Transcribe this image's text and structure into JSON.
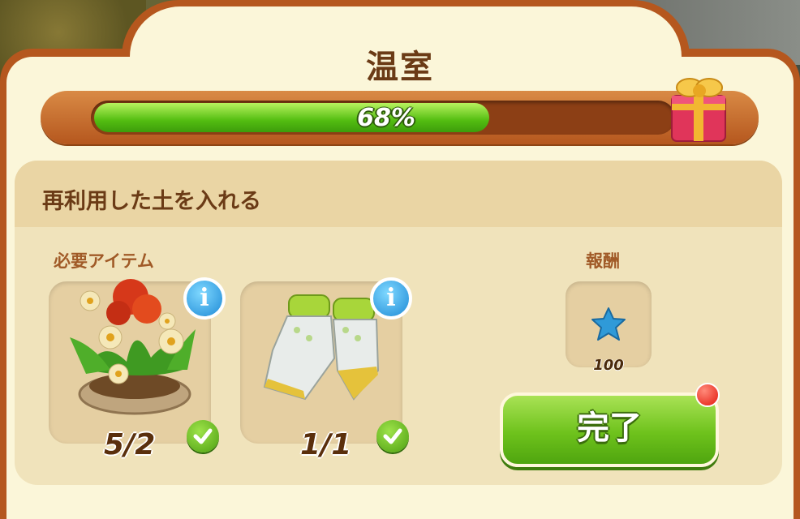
{
  "window": {
    "title": "温室"
  },
  "progress": {
    "label": "68%",
    "value": 0.68
  },
  "task": {
    "title": "再利用した土を入れる"
  },
  "required": {
    "label": "必要アイテム",
    "items": [
      {
        "icon": "flower-pot-icon",
        "count": "5/2",
        "complete": true
      },
      {
        "icon": "gardening-gloves-icon",
        "count": "1/1",
        "complete": true
      }
    ]
  },
  "reward": {
    "label": "報酬",
    "icon": "blue-star-icon",
    "amount": "100"
  },
  "actions": {
    "complete_label": "完了"
  },
  "colors": {
    "frame": "#b5571e",
    "panel": "#fbf6d9",
    "accent_green": "#6ec21c",
    "title_brown": "#6b3b16"
  }
}
